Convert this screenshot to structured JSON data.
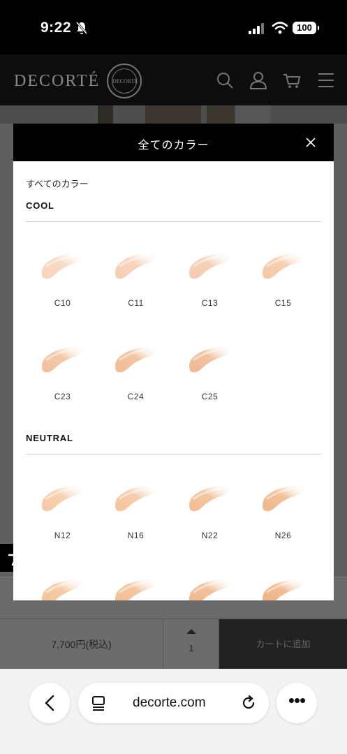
{
  "status_bar": {
    "time": "9:22",
    "battery": "100"
  },
  "site": {
    "logo_text": "DECORTÉ",
    "seal_text": "DECORTÉ"
  },
  "modal": {
    "title": "全てのカラー",
    "subtitle": "すべてのカラー",
    "groups": [
      {
        "name": "COOL",
        "shades": [
          "C10",
          "C11",
          "C13",
          "C15",
          "C23",
          "C24",
          "C25"
        ]
      },
      {
        "name": "NEUTRAL",
        "shades": [
          "N12",
          "N16",
          "N22",
          "N26"
        ]
      }
    ],
    "swatch_colors": {
      "C10": "#f7d3bd",
      "C11": "#f6cdb1",
      "C13": "#f5caac",
      "C15": "#f4c7a6",
      "C23": "#f2c09c",
      "C24": "#f0bb94",
      "C25": "#efb890",
      "N12": "#f5c9a4",
      "N16": "#f4c49c",
      "N22": "#f1bd92",
      "N26": "#efb68a"
    }
  },
  "purchase": {
    "price": "7,700円(税込)",
    "quantity": "1",
    "add_to_cart": "カートに追加"
  },
  "browser": {
    "url": "decorte.com"
  }
}
